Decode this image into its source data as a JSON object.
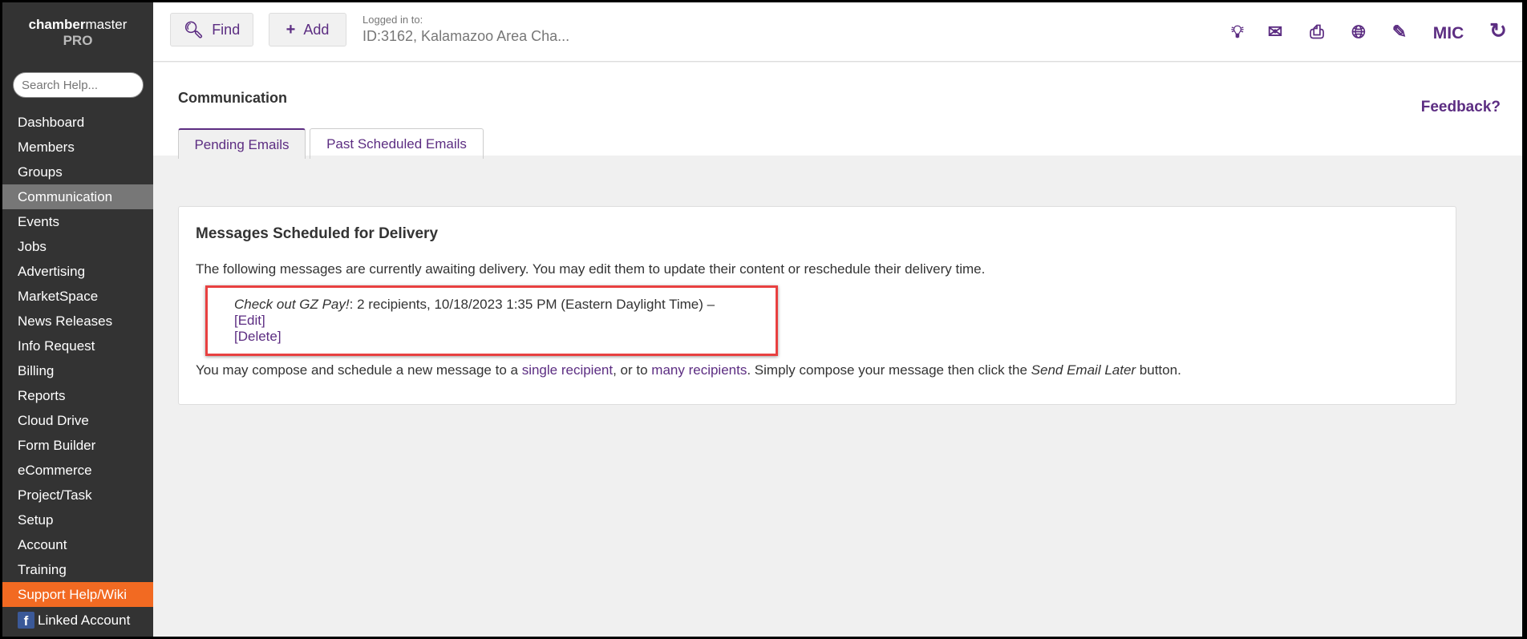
{
  "logo": {
    "bold": "chamber",
    "rest": "master",
    "sub": "PRO"
  },
  "search": {
    "placeholder": "Search Help..."
  },
  "sidebar": {
    "items": [
      "Dashboard",
      "Members",
      "Groups",
      "Communication",
      "Events",
      "Jobs",
      "Advertising",
      "MarketSpace",
      "News Releases",
      "Info Request",
      "Billing",
      "Reports",
      "Cloud Drive",
      "Form Builder",
      "eCommerce",
      "Project/Task",
      "Setup",
      "Account",
      "Training",
      "Support Help/Wiki"
    ],
    "active": "Communication",
    "linked": "Linked Account"
  },
  "topbar": {
    "find": "Find",
    "add": "Add",
    "logged_label": "Logged in to:",
    "logged_value": "ID:3162, Kalamazoo Area Cha...",
    "user": "MIC",
    "icons": [
      "lightbulb-icon",
      "envelope-icon",
      "print-icon",
      "globe-icon",
      "pencil-icon",
      "refresh-icon"
    ]
  },
  "page": {
    "title": "Communication",
    "feedback": "Feedback?",
    "tabs": [
      "Pending Emails",
      "Past Scheduled Emails"
    ]
  },
  "panel": {
    "heading": "Messages Scheduled for Delivery",
    "intro": "The following messages are currently awaiting delivery. You may edit them to update their content or reschedule their delivery time.",
    "message": {
      "subject": "Check out GZ Pay!",
      "details": ": 2 recipients, 10/18/2023 1:35 PM (Eastern Daylight Time) –",
      "edit": "[Edit]",
      "delete": "[Delete]"
    },
    "outro_1": "You may compose and schedule a new message to a ",
    "link_single": "single recipient",
    "outro_2": ", or to ",
    "link_many": "many recipients",
    "outro_3": ". Simply compose your message then click the ",
    "outro_em": "Send Email Later",
    "outro_4": " button."
  },
  "colors": {
    "accent": "#5c2d82",
    "sidebar": "#333333",
    "support": "#f26a22",
    "highlight": "#e84040"
  }
}
